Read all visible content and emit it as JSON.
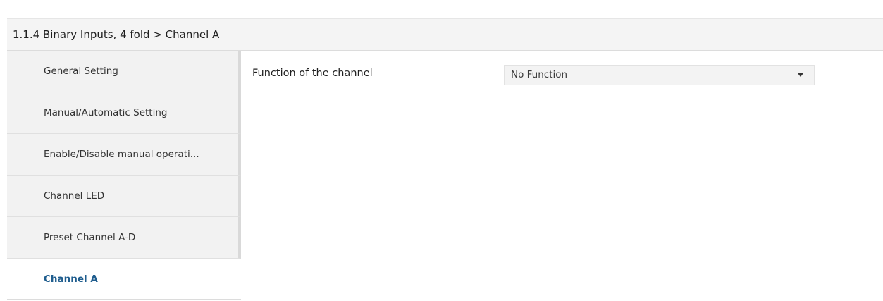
{
  "header": {
    "title": "1.1.4 Binary Inputs, 4 fold > Channel A"
  },
  "sidebar": {
    "items": [
      {
        "label": "General Setting",
        "active": false
      },
      {
        "label": "Manual/Automatic Setting",
        "active": false
      },
      {
        "label": "Enable/Disable manual operati...",
        "active": false
      },
      {
        "label": "Channel LED",
        "active": false
      },
      {
        "label": "Preset Channel A-D",
        "active": false
      },
      {
        "label": "Channel A",
        "active": true
      }
    ]
  },
  "main": {
    "parameters": [
      {
        "label": "Function of the channel",
        "selected": "No Function",
        "icon": "chevron-down-icon"
      }
    ]
  },
  "colors": {
    "active_item_text": "#1f5d8e",
    "header_bg": "#f4f4f4",
    "sidebar_bg": "#f2f2f2"
  }
}
